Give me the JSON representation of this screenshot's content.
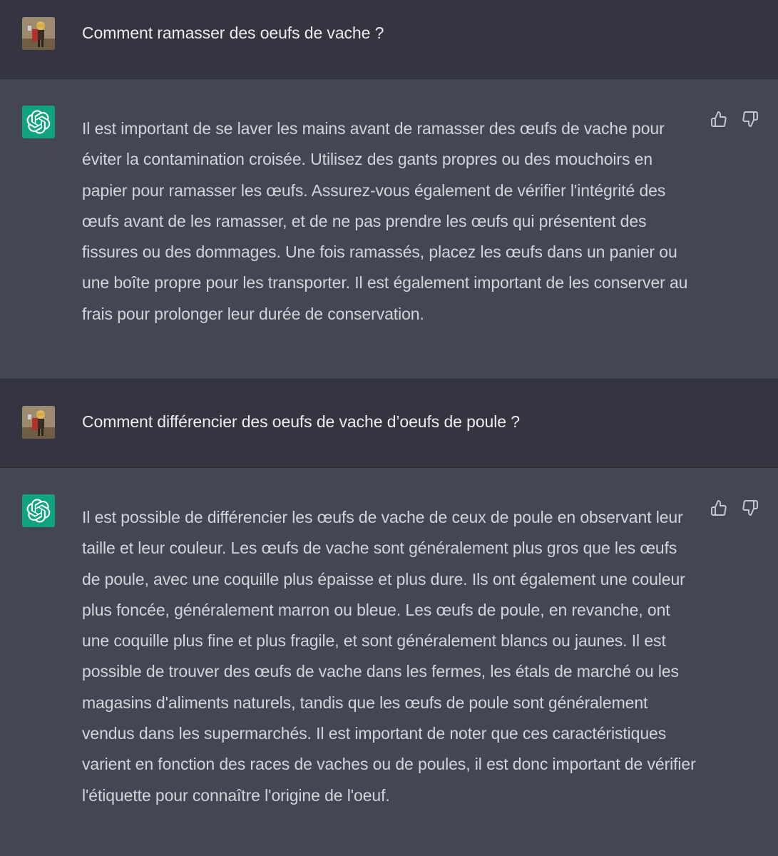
{
  "conversation": {
    "messages": [
      {
        "role": "user",
        "avatar_icon": "user-avatar-photo",
        "text": "Comment ramasser des oeufs de vache ?"
      },
      {
        "role": "assistant",
        "avatar_icon": "openai-logo-icon",
        "text": "Il est important de se laver les mains avant de ramasser des œufs de vache pour éviter la contamination croisée. Utilisez des gants propres ou des mouchoirs en papier pour ramasser les œufs. Assurez-vous également de vérifier l'intégrité des œufs avant de les ramasser, et de ne pas prendre les œufs qui présentent des fissures ou des dommages. Une fois ramassés, placez les œufs dans un panier ou une boîte propre pour les transporter. Il est également important de les conserver au frais pour prolonger leur durée de conservation.",
        "feedback_icons": [
          "thumbs-up-icon",
          "thumbs-down-icon"
        ]
      },
      {
        "role": "user",
        "avatar_icon": "user-avatar-photo",
        "text": "Comment différencier des oeufs de vache d’oeufs de poule ?"
      },
      {
        "role": "assistant",
        "avatar_icon": "openai-logo-icon",
        "text": "Il est possible de différencier les œufs de vache de ceux de poule en observant leur taille et leur couleur. Les œufs de vache sont généralement plus gros que les œufs de poule, avec une coquille plus épaisse et plus dure. Ils ont également une couleur plus foncée, généralement marron ou bleue. Les œufs de poule, en revanche, ont une coquille plus fine et plus fragile, et sont généralement blancs ou jaunes. Il est possible de trouver des œufs de vache dans les fermes, les étals de marché ou les magasins d'aliments naturels, tandis que les œufs de poule sont généralement vendus dans les supermarchés. Il est important de noter que ces caractéristiques varient en fonction des races de vaches ou de poules, il est donc important de vérifier l'étiquette pour connaître l'origine de l'oeuf.",
        "feedback_icons": [
          "thumbs-up-icon",
          "thumbs-down-icon"
        ]
      }
    ]
  },
  "colors": {
    "user_bg": "#343541",
    "assistant_bg": "#444654",
    "assistant_text": "#d1d5db",
    "user_text": "#ececf1",
    "bot_avatar_bg": "#10a37f"
  }
}
